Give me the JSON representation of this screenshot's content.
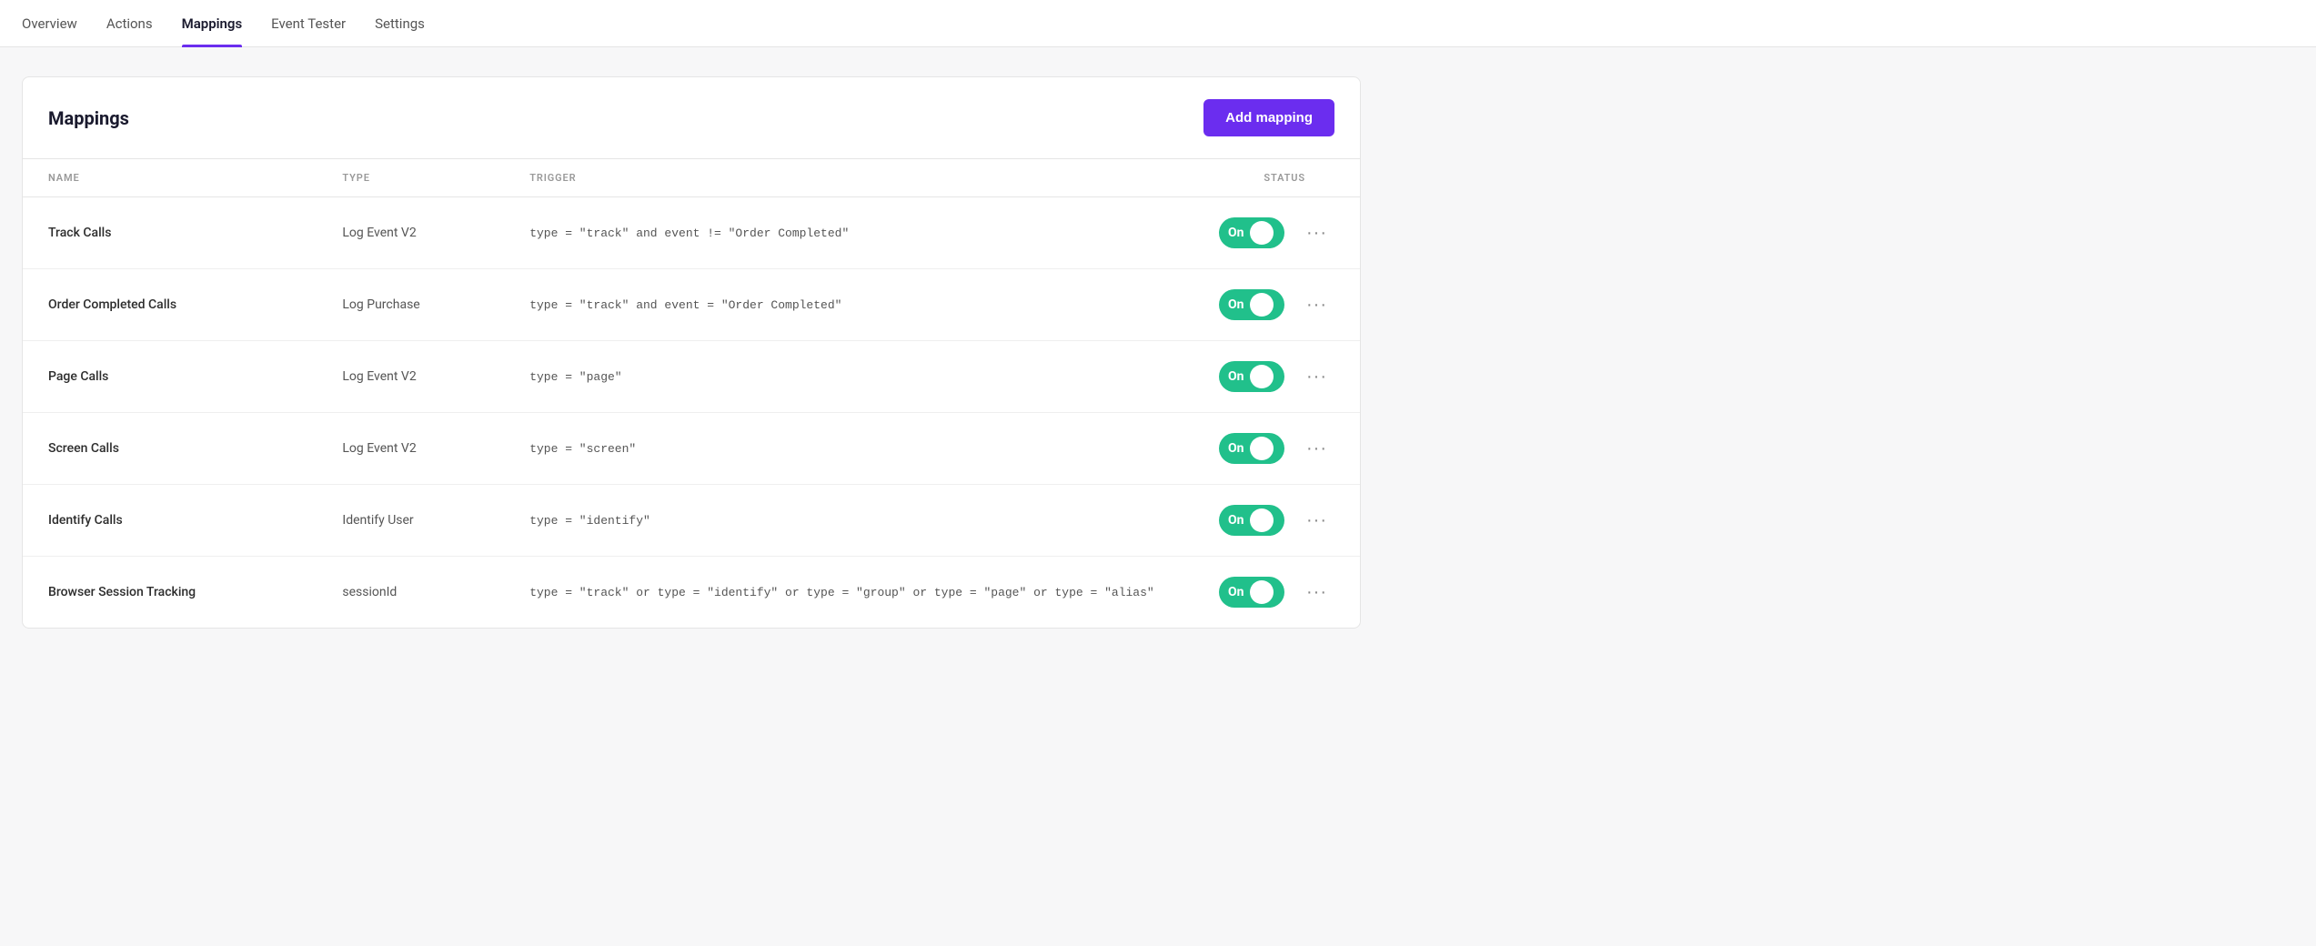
{
  "nav": {
    "items": [
      {
        "label": "Overview",
        "active": false
      },
      {
        "label": "Actions",
        "active": false
      },
      {
        "label": "Mappings",
        "active": true
      },
      {
        "label": "Event Tester",
        "active": false
      },
      {
        "label": "Settings",
        "active": false
      }
    ]
  },
  "page": {
    "title": "Mappings",
    "add_button_label": "Add mapping"
  },
  "table": {
    "columns": {
      "name": "NAME",
      "type": "TYPE",
      "trigger": "TRIGGER",
      "status": "STATUS"
    },
    "rows": [
      {
        "name": "Track Calls",
        "type": "Log Event V2",
        "trigger": "type = \"track\" and event != \"Order Completed\"",
        "status": "On",
        "enabled": true
      },
      {
        "name": "Order Completed Calls",
        "type": "Log Purchase",
        "trigger": "type = \"track\" and event = \"Order Completed\"",
        "status": "On",
        "enabled": true
      },
      {
        "name": "Page Calls",
        "type": "Log Event V2",
        "trigger": "type = \"page\"",
        "status": "On",
        "enabled": true
      },
      {
        "name": "Screen Calls",
        "type": "Log Event V2",
        "trigger": "type = \"screen\"",
        "status": "On",
        "enabled": true
      },
      {
        "name": "Identify Calls",
        "type": "Identify User",
        "trigger": "type = \"identify\"",
        "status": "On",
        "enabled": true
      },
      {
        "name": "Browser Session Tracking",
        "type": "sessionId",
        "trigger": "type = \"track\" or type = \"identify\" or type = \"group\" or type = \"page\" or type = \"alias\"",
        "status": "On",
        "enabled": true
      }
    ]
  },
  "colors": {
    "toggle_on": "#21c08b",
    "accent": "#6b2def"
  }
}
